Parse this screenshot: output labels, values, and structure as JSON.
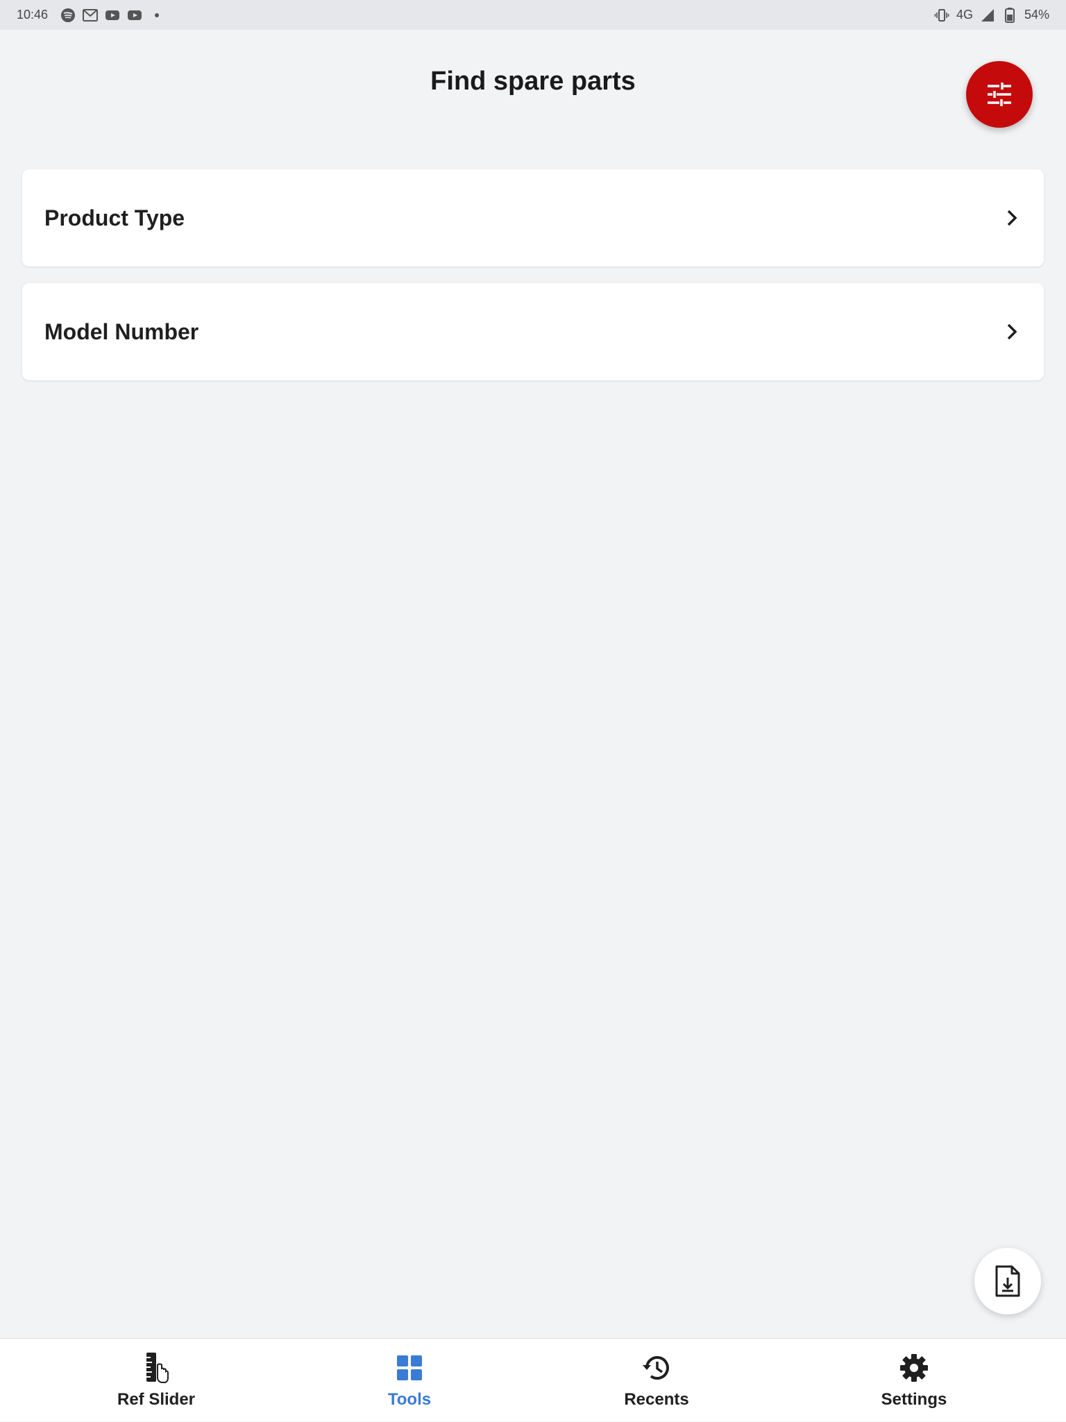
{
  "status_bar": {
    "time": "10:46",
    "network": "4G",
    "battery": "54%",
    "notification_icons": [
      "spotify-icon",
      "gmail-icon",
      "youtube-icon",
      "youtube-icon",
      "dot-icon"
    ]
  },
  "header": {
    "title": "Find spare parts",
    "filter_icon": "tune-sliders-icon"
  },
  "menu": {
    "items": [
      {
        "label": "Product Type",
        "icon": "chevron-right-icon"
      },
      {
        "label": "Model Number",
        "icon": "chevron-right-icon"
      }
    ]
  },
  "download_fab": {
    "icon": "file-download-icon"
  },
  "bottom_nav": {
    "items": [
      {
        "label": "Ref Slider",
        "icon": "ruler-hand-icon",
        "active": false
      },
      {
        "label": "Tools",
        "icon": "grid-icon",
        "active": true
      },
      {
        "label": "Recents",
        "icon": "history-icon",
        "active": false
      },
      {
        "label": "Settings",
        "icon": "gear-icon",
        "active": false
      }
    ]
  },
  "colors": {
    "accent_red": "#c40a0a",
    "active_blue": "#3a7bd5",
    "background": "#f2f3f5"
  }
}
